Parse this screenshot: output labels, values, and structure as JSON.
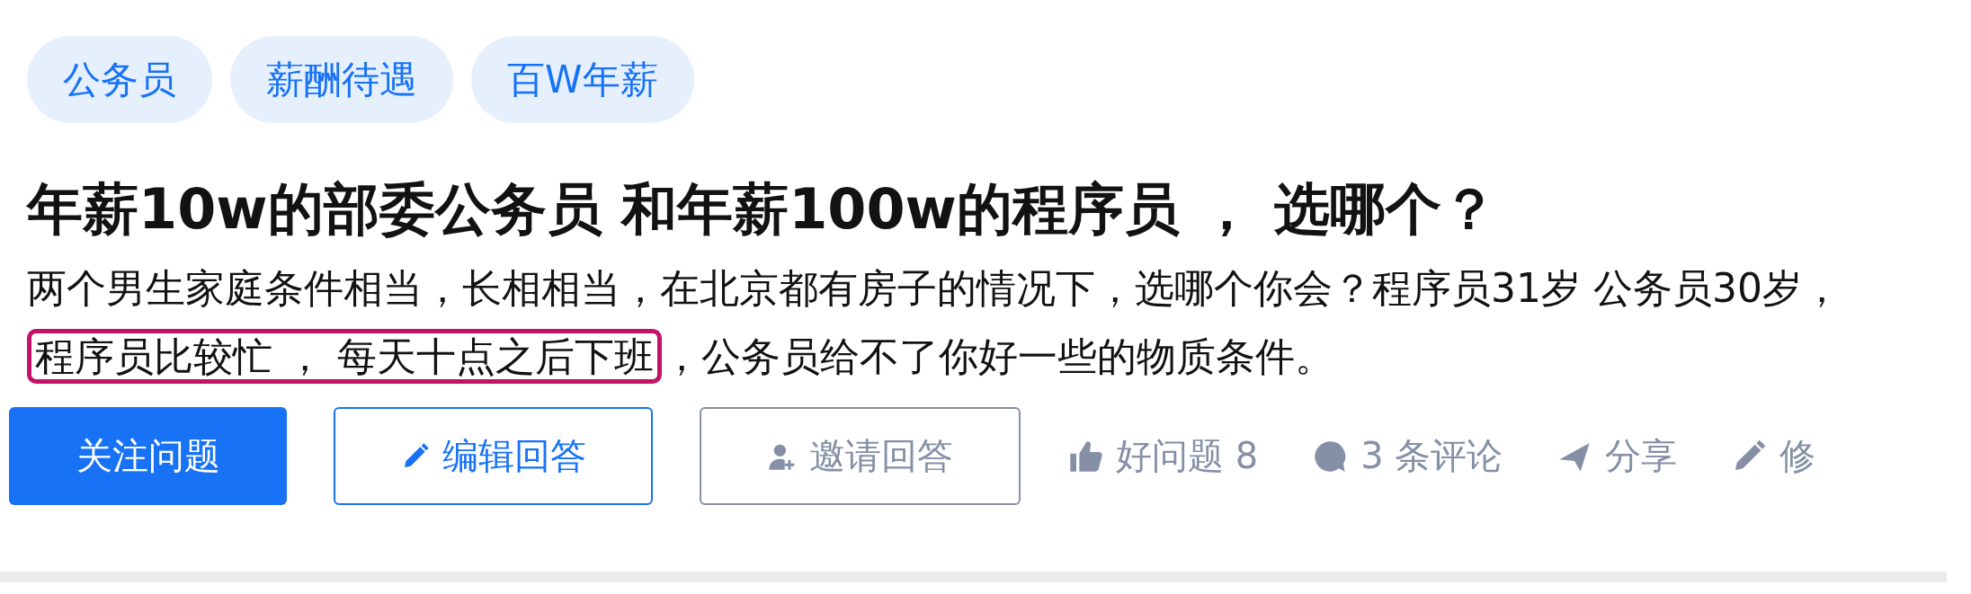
{
  "tags": [
    "公务员",
    "薪酬待遇",
    "百W年薪"
  ],
  "title": "年薪10w的部委公务员 和年薪100w的程序员 ， 选哪个？",
  "description": [
    {
      "kind": "text",
      "text": "两个男生家庭条件相当，长相相当，在北京都有房子的情况下，选哪个你会？程序员31岁 公务员30岁，"
    },
    {
      "kind": "highlight",
      "text": "程序员比较忙 ， 每天十点之后下班"
    },
    {
      "kind": "text",
      "text": "，公务员给不了你好一些的物质条件。"
    }
  ],
  "buttons": [
    {
      "kind": "primary",
      "label": "关注问题"
    },
    {
      "kind": "outline",
      "label": "编辑回答"
    },
    {
      "kind": "plain",
      "label": "邀请回答"
    }
  ],
  "actions": [
    {
      "label": "好问题 8"
    },
    {
      "label": "3 条评论"
    },
    {
      "label": "分享"
    },
    {
      "label": "修"
    }
  ]
}
